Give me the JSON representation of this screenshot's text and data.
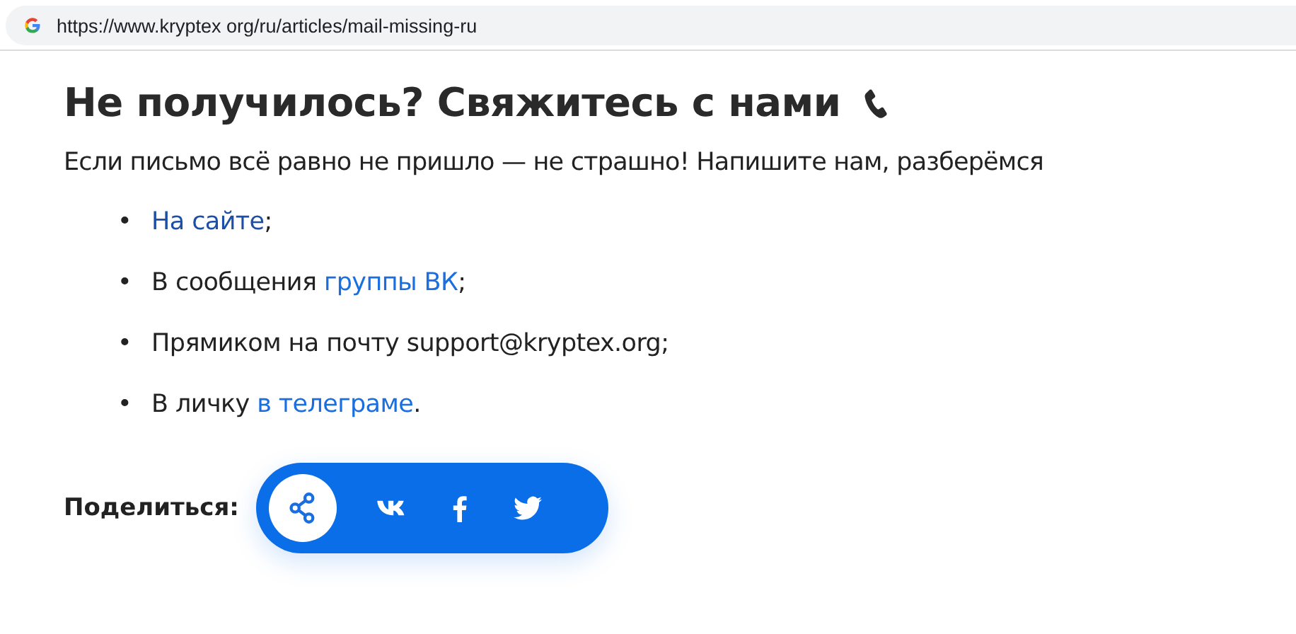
{
  "address_bar": {
    "url": "https://www.kryptex org/ru/articles/mail-missing-ru"
  },
  "heading": "Не получилось? Свяжитесь с нами",
  "intro": "Если письмо всё равно не пришло — не страшно! Напишите нам, разберёмся",
  "bullet": "•",
  "contacts": [
    [
      {
        "text": "На сайте",
        "link": true
      },
      {
        "text": ";",
        "link": false
      }
    ],
    [
      {
        "text": "В сообщения ",
        "link": false
      },
      {
        "text": "группы ВК",
        "link": true
      },
      {
        "text": ";",
        "link": false
      }
    ],
    [
      {
        "text": "Прямиком на почту support@kryptex.org;",
        "link": false
      }
    ],
    [
      {
        "text": "В личку ",
        "link": false
      },
      {
        "text": "в телеграме",
        "link": true
      },
      {
        "text": ".",
        "link": false
      }
    ]
  ],
  "share": {
    "label": "Поделиться:",
    "buttons": [
      {
        "kind": "share"
      },
      {
        "kind": "vk"
      },
      {
        "kind": "facebook"
      },
      {
        "kind": "twitter"
      }
    ]
  }
}
